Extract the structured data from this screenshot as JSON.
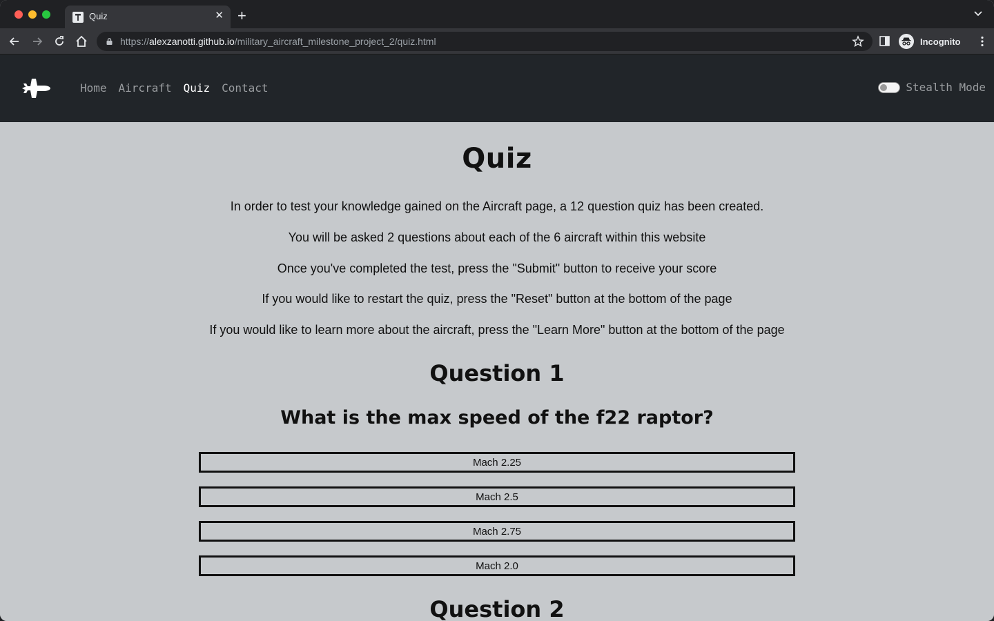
{
  "browser": {
    "tab_title": "Quiz",
    "url_scheme": "https://",
    "url_host": "alexzanotti.github.io",
    "url_path": "/military_aircraft_milestone_project_2/quiz.html",
    "profile_label": "Incognito"
  },
  "navbar": {
    "links": [
      {
        "label": "Home",
        "active": false
      },
      {
        "label": "Aircraft",
        "active": false
      },
      {
        "label": "Quiz",
        "active": true
      },
      {
        "label": "Contact",
        "active": false
      }
    ],
    "stealth_label": "Stealth Mode",
    "stealth_on": false
  },
  "page": {
    "title": "Quiz",
    "intro": [
      "In order to test your knowledge gained on the Aircraft page, a 12 question quiz has been created.",
      "You will be asked 2 questions about each of the 6 aircraft within this website",
      "Once you've completed the test, press the \"Submit\" button to receive your score",
      "If you would like to restart the quiz, press the \"Reset\" button at the bottom of the page",
      "If you would like to learn more about the aircraft, press the \"Learn More\" button at the bottom of the page"
    ],
    "questions": [
      {
        "heading": "Question 1",
        "text": "What is the max speed of the f22 raptor?",
        "answers": [
          "Mach 2.25",
          "Mach 2.5",
          "Mach 2.75",
          "Mach 2.0"
        ]
      },
      {
        "heading": "Question 2"
      }
    ]
  },
  "colors": {
    "page_bg": "#c6c9cc",
    "navbar_bg": "#212529",
    "nav_inactive": "#9a9da0",
    "nav_active": "#ffffff"
  }
}
